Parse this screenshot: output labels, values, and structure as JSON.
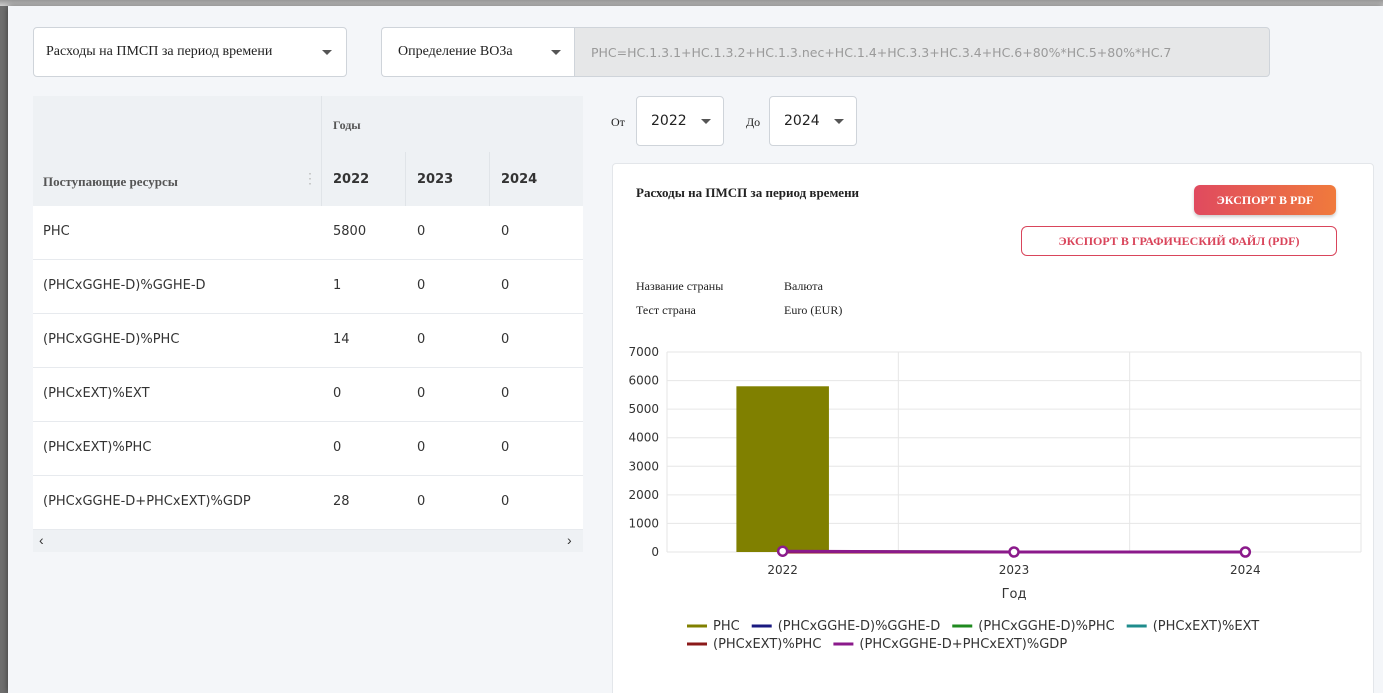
{
  "filters": {
    "expense_select": "Расходы на ПМСП за период времени",
    "definition_select": "Определение ВОЗа",
    "formula": "PHC=HC.1.3.1+HC.1.3.2+HC.1.3.nec+HC.1.4+HC.3.3+HC.3.4+HC.6+80%*HC.5+80%*HC.7"
  },
  "table": {
    "group_header": "Годы",
    "resource_header": "Поступающие ресурсы",
    "years": [
      "2022",
      "2023",
      "2024"
    ],
    "rows": [
      {
        "name": "PHC",
        "values": [
          "5800",
          "0",
          "0"
        ]
      },
      {
        "name": "(PHCxGGHE-D)%GGHE-D",
        "values": [
          "1",
          "0",
          "0"
        ]
      },
      {
        "name": "(PHCxGGHE-D)%PHC",
        "values": [
          "14",
          "0",
          "0"
        ]
      },
      {
        "name": "(PHCxEXT)%EXT",
        "values": [
          "0",
          "0",
          "0"
        ]
      },
      {
        "name": "(PHCxEXT)%PHC",
        "values": [
          "0",
          "0",
          "0"
        ]
      },
      {
        "name": "(PHCxGGHE-D+PHCxEXT)%GDP",
        "values": [
          "28",
          "0",
          "0"
        ]
      }
    ],
    "scroll_left": "‹",
    "scroll_right": "›"
  },
  "range": {
    "from_label": "От",
    "from_value": "2022",
    "to_label": "До",
    "to_value": "2024"
  },
  "panel": {
    "title": "Расходы на ПМСП за период времени",
    "export_pdf": "ЭКСПОРТ В PDF",
    "export_image": "ЭКСПОРТ В ГРАФИЧЕСКИЙ ФАЙЛ (PDF)",
    "country_label": "Название страны",
    "country_value": "Тест страна",
    "currency_label": "Валюта",
    "currency_value": "Euro (EUR)"
  },
  "chart_data": {
    "type": "bar",
    "categories": [
      "2022",
      "2023",
      "2024"
    ],
    "xlabel": "Год",
    "ylabel": "",
    "ylim": [
      0,
      7000
    ],
    "yticks": [
      0,
      1000,
      2000,
      3000,
      4000,
      5000,
      6000,
      7000
    ],
    "grid": true,
    "legend_position": "bottom",
    "series": [
      {
        "name": "PHC",
        "kind": "bar",
        "color": "#808000",
        "values": [
          5800,
          0,
          0
        ]
      },
      {
        "name": "(PHCxGGHE-D)%GGHE-D",
        "kind": "line",
        "color": "#1a1a80",
        "values": [
          1,
          0,
          0
        ]
      },
      {
        "name": "(PHCxGGHE-D)%PHC",
        "kind": "line",
        "color": "#1f8a1f",
        "values": [
          14,
          0,
          0
        ]
      },
      {
        "name": "(PHCxEXT)%EXT",
        "kind": "line",
        "color": "#1f8c8c",
        "values": [
          0,
          0,
          0
        ]
      },
      {
        "name": "(PHCxEXT)%PHC",
        "kind": "line",
        "color": "#8b1a1a",
        "values": [
          0,
          0,
          0
        ]
      },
      {
        "name": "(PHCxGGHE-D+PHCxEXT)%GDP",
        "kind": "line",
        "color": "#8b1a8b",
        "values": [
          28,
          0,
          0
        ]
      }
    ]
  }
}
